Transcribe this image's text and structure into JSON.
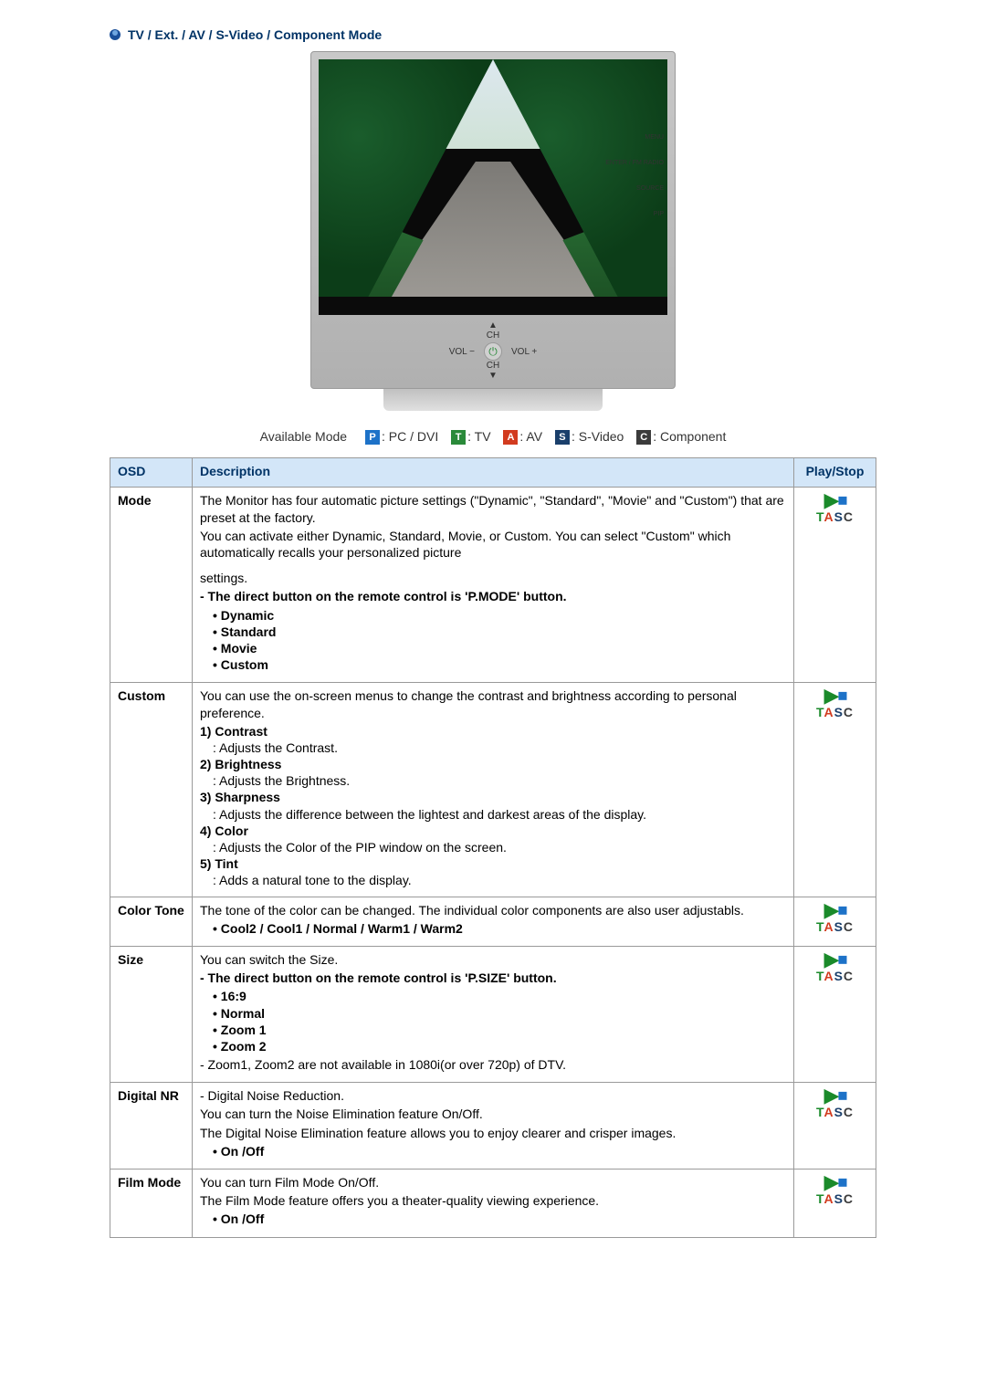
{
  "section_title": "TV / Ext. / AV / S-Video / Component Mode",
  "tv_controls": {
    "ch_up": "CH",
    "ch_down": "CH",
    "vol_minus": "VOL\n−",
    "vol_plus": "VOL\n+",
    "side": [
      "MENU",
      "",
      "ENTER /\nFM RADIO",
      "SOURCE",
      "PIP",
      ""
    ]
  },
  "legend": {
    "label": "Available Mode",
    "modes": [
      {
        "badge": "P",
        "text": ": PC / DVI"
      },
      {
        "badge": "T",
        "text": ": TV"
      },
      {
        "badge": "A",
        "text": ": AV"
      },
      {
        "badge": "S",
        "text": ": S-Video"
      },
      {
        "badge": "C",
        "text": ": Component"
      }
    ]
  },
  "table_headers": {
    "osd": "OSD",
    "description": "Description",
    "playstop": "Play/Stop"
  },
  "tasc_letters": {
    "t": "T",
    "a": "A",
    "s": "S",
    "c": "C"
  },
  "rows": {
    "mode": {
      "label": "Mode",
      "p1": "The Monitor has four automatic picture settings (\"Dynamic\", \"Standard\", \"Movie\" and \"Custom\") that are preset at the factory.",
      "p2": "You can activate either Dynamic, Standard, Movie, or Custom. You can select \"Custom\" which automatically recalls your personalized picture",
      "p3": "settings.",
      "note": "- The direct button on the remote control is 'P.MODE' button.",
      "items": [
        "Dynamic",
        "Standard",
        "Movie",
        "Custom"
      ]
    },
    "custom": {
      "label": "Custom",
      "intro": "You can use the on-screen menus to change the contrast and brightness according to personal preference.",
      "items": [
        {
          "title": "1) Contrast",
          "sub": ": Adjusts the Contrast."
        },
        {
          "title": "2) Brightness",
          "sub": ": Adjusts the Brightness."
        },
        {
          "title": "3) Sharpness",
          "sub": ": Adjusts the difference between the lightest and darkest areas of the display."
        },
        {
          "title": "4) Color",
          "sub": ": Adjusts the Color of the PIP window on the screen."
        },
        {
          "title": "5) Tint",
          "sub": ": Adds a natural tone to the display."
        }
      ]
    },
    "color_tone": {
      "label": "Color Tone",
      "p1": "The tone of the color can be changed. The individual color components are also user adjustabls.",
      "opts": "Cool2 / Cool1 / Normal / Warm1 / Warm2"
    },
    "size": {
      "label": "Size",
      "p1": "You can switch the Size.",
      "note": "- The direct button on the remote control is 'P.SIZE' button.",
      "items": [
        "16:9",
        "Normal",
        "Zoom 1",
        "Zoom 2"
      ],
      "footnote": "- Zoom1, Zoom2 are not available in 1080i(or over 720p) of DTV."
    },
    "digital_nr": {
      "label": "Digital NR",
      "p1": "- Digital Noise Reduction.",
      "p2": "You can turn the Noise Elimination feature On/Off.",
      "p3": "The Digital Noise Elimination feature allows you to enjoy clearer and crisper images.",
      "opts": "On /Off"
    },
    "film_mode": {
      "label": "Film Mode",
      "p1": "You can turn Film Mode On/Off.",
      "p2": "The Film Mode feature offers you a theater-quality viewing experience.",
      "opts": "On /Off"
    }
  }
}
